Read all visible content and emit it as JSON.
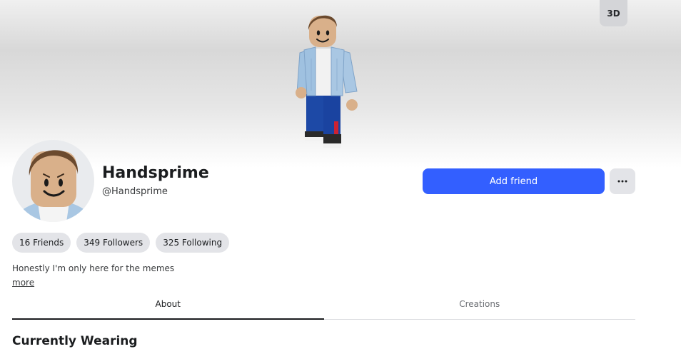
{
  "banner": {
    "view_3d_label": "3D"
  },
  "profile": {
    "display_name": "Handsprime",
    "username": "@Handsprime",
    "add_friend_label": "Add friend",
    "more_options_icon": "ellipsis-icon",
    "bio": "Honestly I'm only here for the memes",
    "bio_more_label": "more"
  },
  "stats": {
    "friends": "16 Friends",
    "followers": "349 Followers",
    "following": "325 Following"
  },
  "tabs": [
    {
      "label": "About",
      "active": true
    },
    {
      "label": "Creations",
      "active": false
    }
  ],
  "sections": {
    "currently_wearing": "Currently Wearing"
  },
  "colors": {
    "accent": "#335fff",
    "pill_bg": "#e3e4e8",
    "text_primary": "#1b1d1f"
  }
}
